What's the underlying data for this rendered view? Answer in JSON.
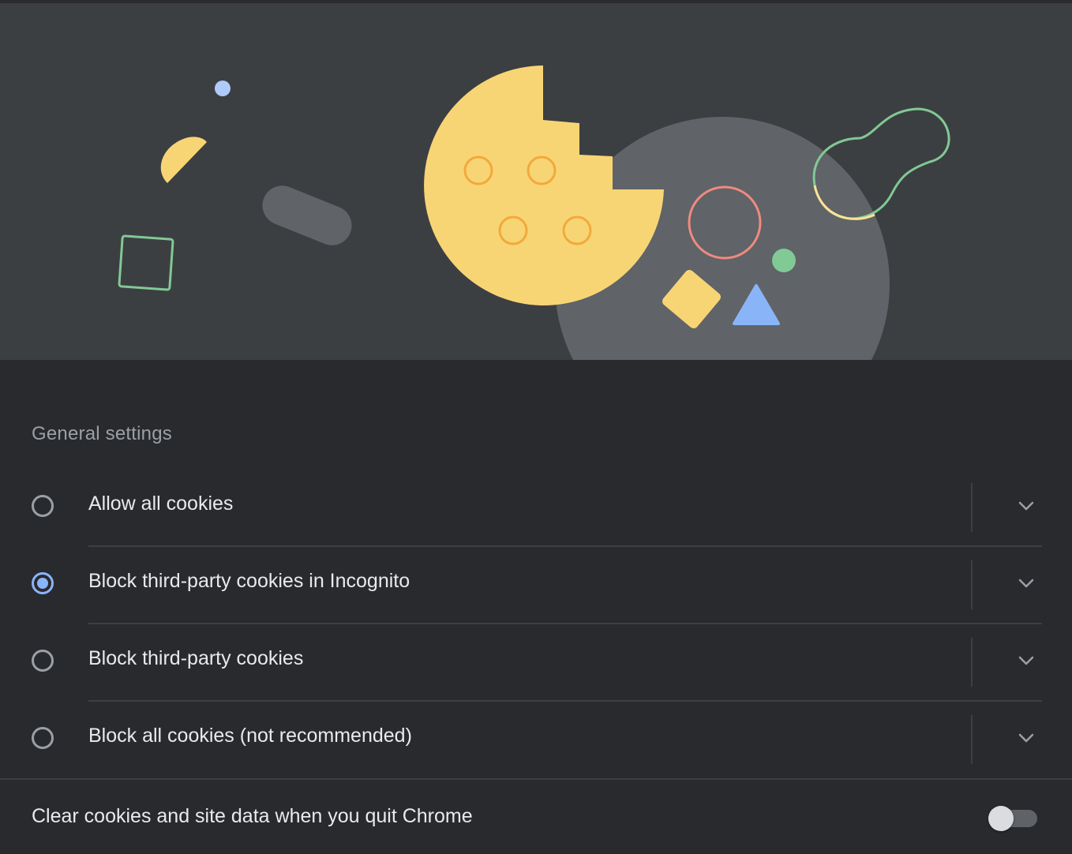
{
  "colors": {
    "page_bg": "#292a2d",
    "hero_bg": "#3c3f42",
    "cookie_yellow": "#f8d574",
    "cookie_crumb": "#f2a93b",
    "blob_gray": "#606367",
    "accent_blue": "#8ab4f8",
    "green": "#81c995",
    "red": "#ee8b7e",
    "muted_text": "#9aa0a6",
    "text": "#e8eaed"
  },
  "hero": {
    "illustration": "cookie-illustration"
  },
  "general_settings": {
    "title": "General settings",
    "options": [
      {
        "label": "Allow all cookies",
        "checked": false,
        "icon": "chevron-down-icon"
      },
      {
        "label": "Block third-party cookies in Incognito",
        "checked": true,
        "icon": "chevron-down-icon"
      },
      {
        "label": "Block third-party cookies",
        "checked": false,
        "icon": "chevron-down-icon"
      },
      {
        "label": "Block all cookies (not recommended)",
        "checked": false,
        "icon": "chevron-down-icon"
      }
    ]
  },
  "clear_on_exit": {
    "label": "Clear cookies and site data when you quit Chrome",
    "enabled": false
  }
}
